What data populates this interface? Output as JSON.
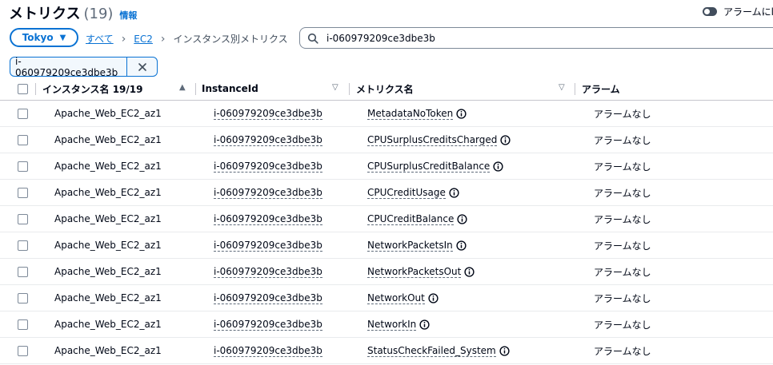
{
  "header": {
    "title": "メトリクス",
    "count": "(19)",
    "info_link": "情報"
  },
  "alarm_toggle": {
    "label": "アラームにl"
  },
  "region": {
    "label": "Tokyo",
    "caret": "▼"
  },
  "breadcrumb": {
    "all": "すべて",
    "ec2": "EC2",
    "current": "インスタンス別メトリクス",
    "separator": "›"
  },
  "search": {
    "value": "i-060979209ce3dbe3b"
  },
  "filter_token": {
    "label": "i-060979209ce3dbe3b"
  },
  "table": {
    "headers": {
      "instance_name": "インスタンス名 19/19",
      "instance_id": "InstanceId",
      "metric_name": "メトリクス名",
      "alarm": "アラーム"
    },
    "sort_asc": "▲",
    "sort_none": "▽",
    "rows": [
      {
        "instance_name": "Apache_Web_EC2_az1",
        "instance_id": "i-060979209ce3dbe3b",
        "metric": "MetadataNoToken",
        "alarm": "アラームなし"
      },
      {
        "instance_name": "Apache_Web_EC2_az1",
        "instance_id": "i-060979209ce3dbe3b",
        "metric": "CPUSurplusCreditsCharged",
        "alarm": "アラームなし"
      },
      {
        "instance_name": "Apache_Web_EC2_az1",
        "instance_id": "i-060979209ce3dbe3b",
        "metric": "CPUSurplusCreditBalance",
        "alarm": "アラームなし"
      },
      {
        "instance_name": "Apache_Web_EC2_az1",
        "instance_id": "i-060979209ce3dbe3b",
        "metric": "CPUCreditUsage",
        "alarm": "アラームなし"
      },
      {
        "instance_name": "Apache_Web_EC2_az1",
        "instance_id": "i-060979209ce3dbe3b",
        "metric": "CPUCreditBalance",
        "alarm": "アラームなし"
      },
      {
        "instance_name": "Apache_Web_EC2_az1",
        "instance_id": "i-060979209ce3dbe3b",
        "metric": "NetworkPacketsIn",
        "alarm": "アラームなし"
      },
      {
        "instance_name": "Apache_Web_EC2_az1",
        "instance_id": "i-060979209ce3dbe3b",
        "metric": "NetworkPacketsOut",
        "alarm": "アラームなし"
      },
      {
        "instance_name": "Apache_Web_EC2_az1",
        "instance_id": "i-060979209ce3dbe3b",
        "metric": "NetworkOut",
        "alarm": "アラームなし"
      },
      {
        "instance_name": "Apache_Web_EC2_az1",
        "instance_id": "i-060979209ce3dbe3b",
        "metric": "NetworkIn",
        "alarm": "アラームなし"
      },
      {
        "instance_name": "Apache_Web_EC2_az1",
        "instance_id": "i-060979209ce3dbe3b",
        "metric": "StatusCheckFailed_System",
        "alarm": "アラームなし"
      }
    ]
  },
  "colors": {
    "accent": "#0972d3",
    "text": "#000716",
    "muted": "#5f6b7a",
    "border": "#c6c6cd"
  },
  "icons": {
    "search": "search-icon",
    "edit": "pencil-icon",
    "close": "close-icon",
    "info": "info-icon"
  }
}
